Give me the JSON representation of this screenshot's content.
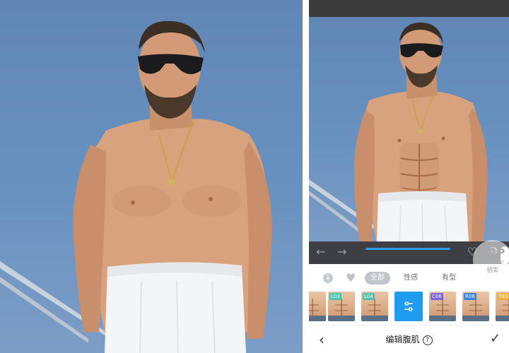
{
  "editor": {
    "controls": {
      "undo_icon": "arrow-left-icon",
      "redo_icon": "arrow-right-icon",
      "favorite_icon": "heart-outline-icon",
      "compare_icon": "compare-icon",
      "effect_strength": 1.0
    },
    "filters": {
      "download_icon": "download-icon",
      "favorites_icon": "heart-icon",
      "all": "全部",
      "sexy": "性感",
      "shaped": "有型"
    },
    "thumbnails": [
      {
        "badge": "",
        "color": "#ffffff"
      },
      {
        "badge": "L03",
        "color": "#4cc4b0"
      },
      {
        "badge": "L04",
        "color": "#4cc4b0"
      },
      {
        "badge": "",
        "selected": true,
        "icon": "sliders-icon"
      },
      {
        "badge": "C06",
        "color": "#7b62d9"
      },
      {
        "badge": "R06",
        "color": "#3b82e0"
      },
      {
        "badge": "T03",
        "color": "#f0b33b"
      }
    ],
    "bottom_bar": {
      "back_icon": "chevron-left-icon",
      "title": "编辑腹肌",
      "help_symbol": "?",
      "confirm_icon": "check-icon"
    }
  },
  "watermark": {
    "line1": "APP",
    "line2": "solution",
    "line3": "招实"
  },
  "colors": {
    "accent": "#1f9bf0",
    "sky": "#6a92c0",
    "toolbar_dark": "#3d3f44"
  }
}
